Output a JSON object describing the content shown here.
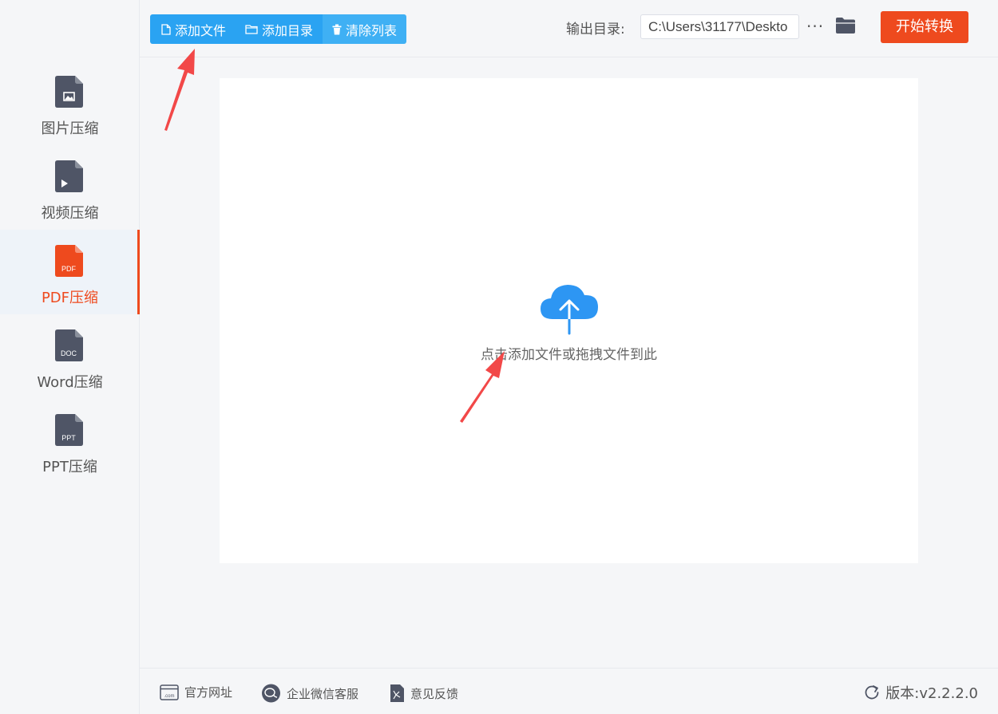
{
  "sidebar": {
    "items": [
      {
        "label": "图片压缩",
        "icon": "image-file-icon",
        "active": false
      },
      {
        "label": "视频压缩",
        "icon": "video-file-icon",
        "active": false
      },
      {
        "label": "PDF压缩",
        "icon": "pdf-file-icon",
        "badge": "PDF",
        "active": true
      },
      {
        "label": "Word压缩",
        "icon": "doc-file-icon",
        "badge": "DOC",
        "active": false
      },
      {
        "label": "PPT压缩",
        "icon": "ppt-file-icon",
        "badge": "PPT",
        "active": false
      }
    ]
  },
  "toolbar": {
    "add_file": "添加文件",
    "add_folder": "添加目录",
    "clear_list": "清除列表",
    "output_label": "输出目录:",
    "output_path": "C:\\Users\\31177\\Deskto",
    "more": "···",
    "start": "开始转换"
  },
  "main": {
    "drop_hint": "点击添加文件或拖拽文件到此"
  },
  "footer": {
    "website": "官方网址",
    "wechat": "企业微信客服",
    "feedback": "意见反馈",
    "version": "版本:v2.2.2.0"
  },
  "colors": {
    "accent": "#ee4a1e",
    "toolbar_blue": "#2aa3f2",
    "icon_dark": "#4f5566",
    "cloud_blue": "#2d96f3",
    "arrow_red": "#f24848"
  }
}
